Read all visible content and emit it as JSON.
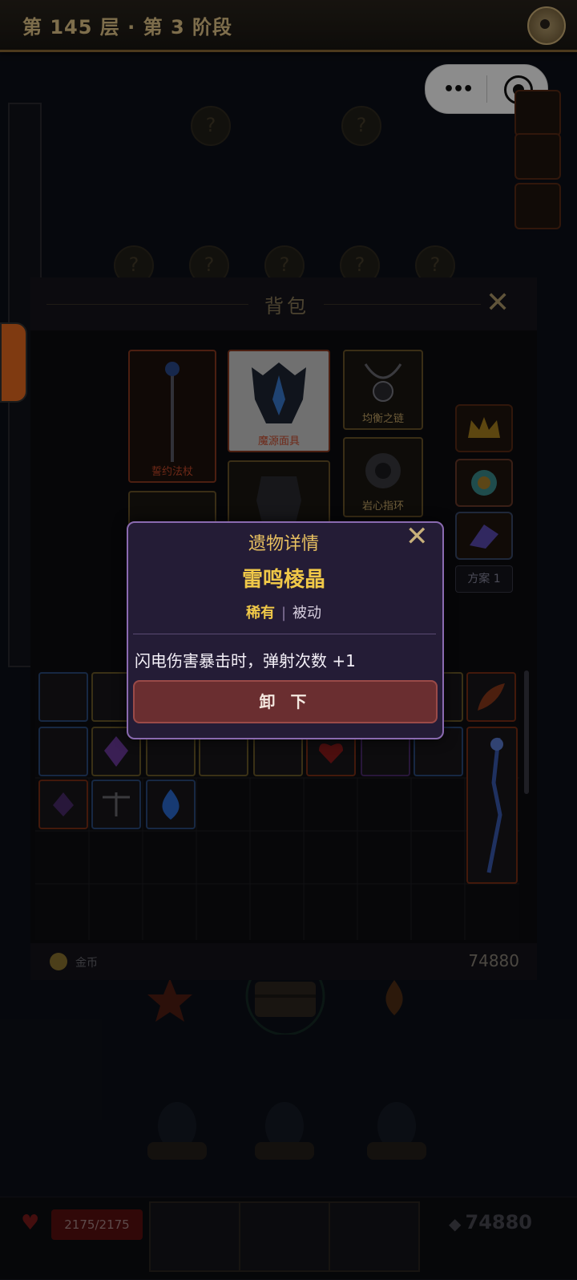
{
  "header": {
    "floor_title": "第 145 层 · 第 3 阶段"
  },
  "backpack": {
    "title": "背包",
    "equipment": [
      {
        "label": "誓约法杖",
        "label_color": "red"
      },
      {
        "label": "魔源面具",
        "label_color": "red"
      },
      {
        "label": "均衡之链",
        "label_color": "gold"
      },
      {
        "label": "岩心指环",
        "label_color": "gold"
      }
    ],
    "scheme_label": "方案 1",
    "gold_label": "金币",
    "gold_amount": "74880"
  },
  "relic_detail": {
    "title": "遗物详情",
    "name": "雷鸣棱晶",
    "rarity": "稀有",
    "separator": "|",
    "type": "被动",
    "description": "闪电伤害暴击时，弹射次数 +1",
    "unequip_label": "卸 下"
  },
  "status_bar": {
    "hp": "2175/2175",
    "gold": "74880"
  },
  "colors": {
    "accent_gold": "#f0c848",
    "popup_bg": "#241c36",
    "popup_border": "#8a6ab0",
    "unequip_button": "#6a2e30"
  }
}
